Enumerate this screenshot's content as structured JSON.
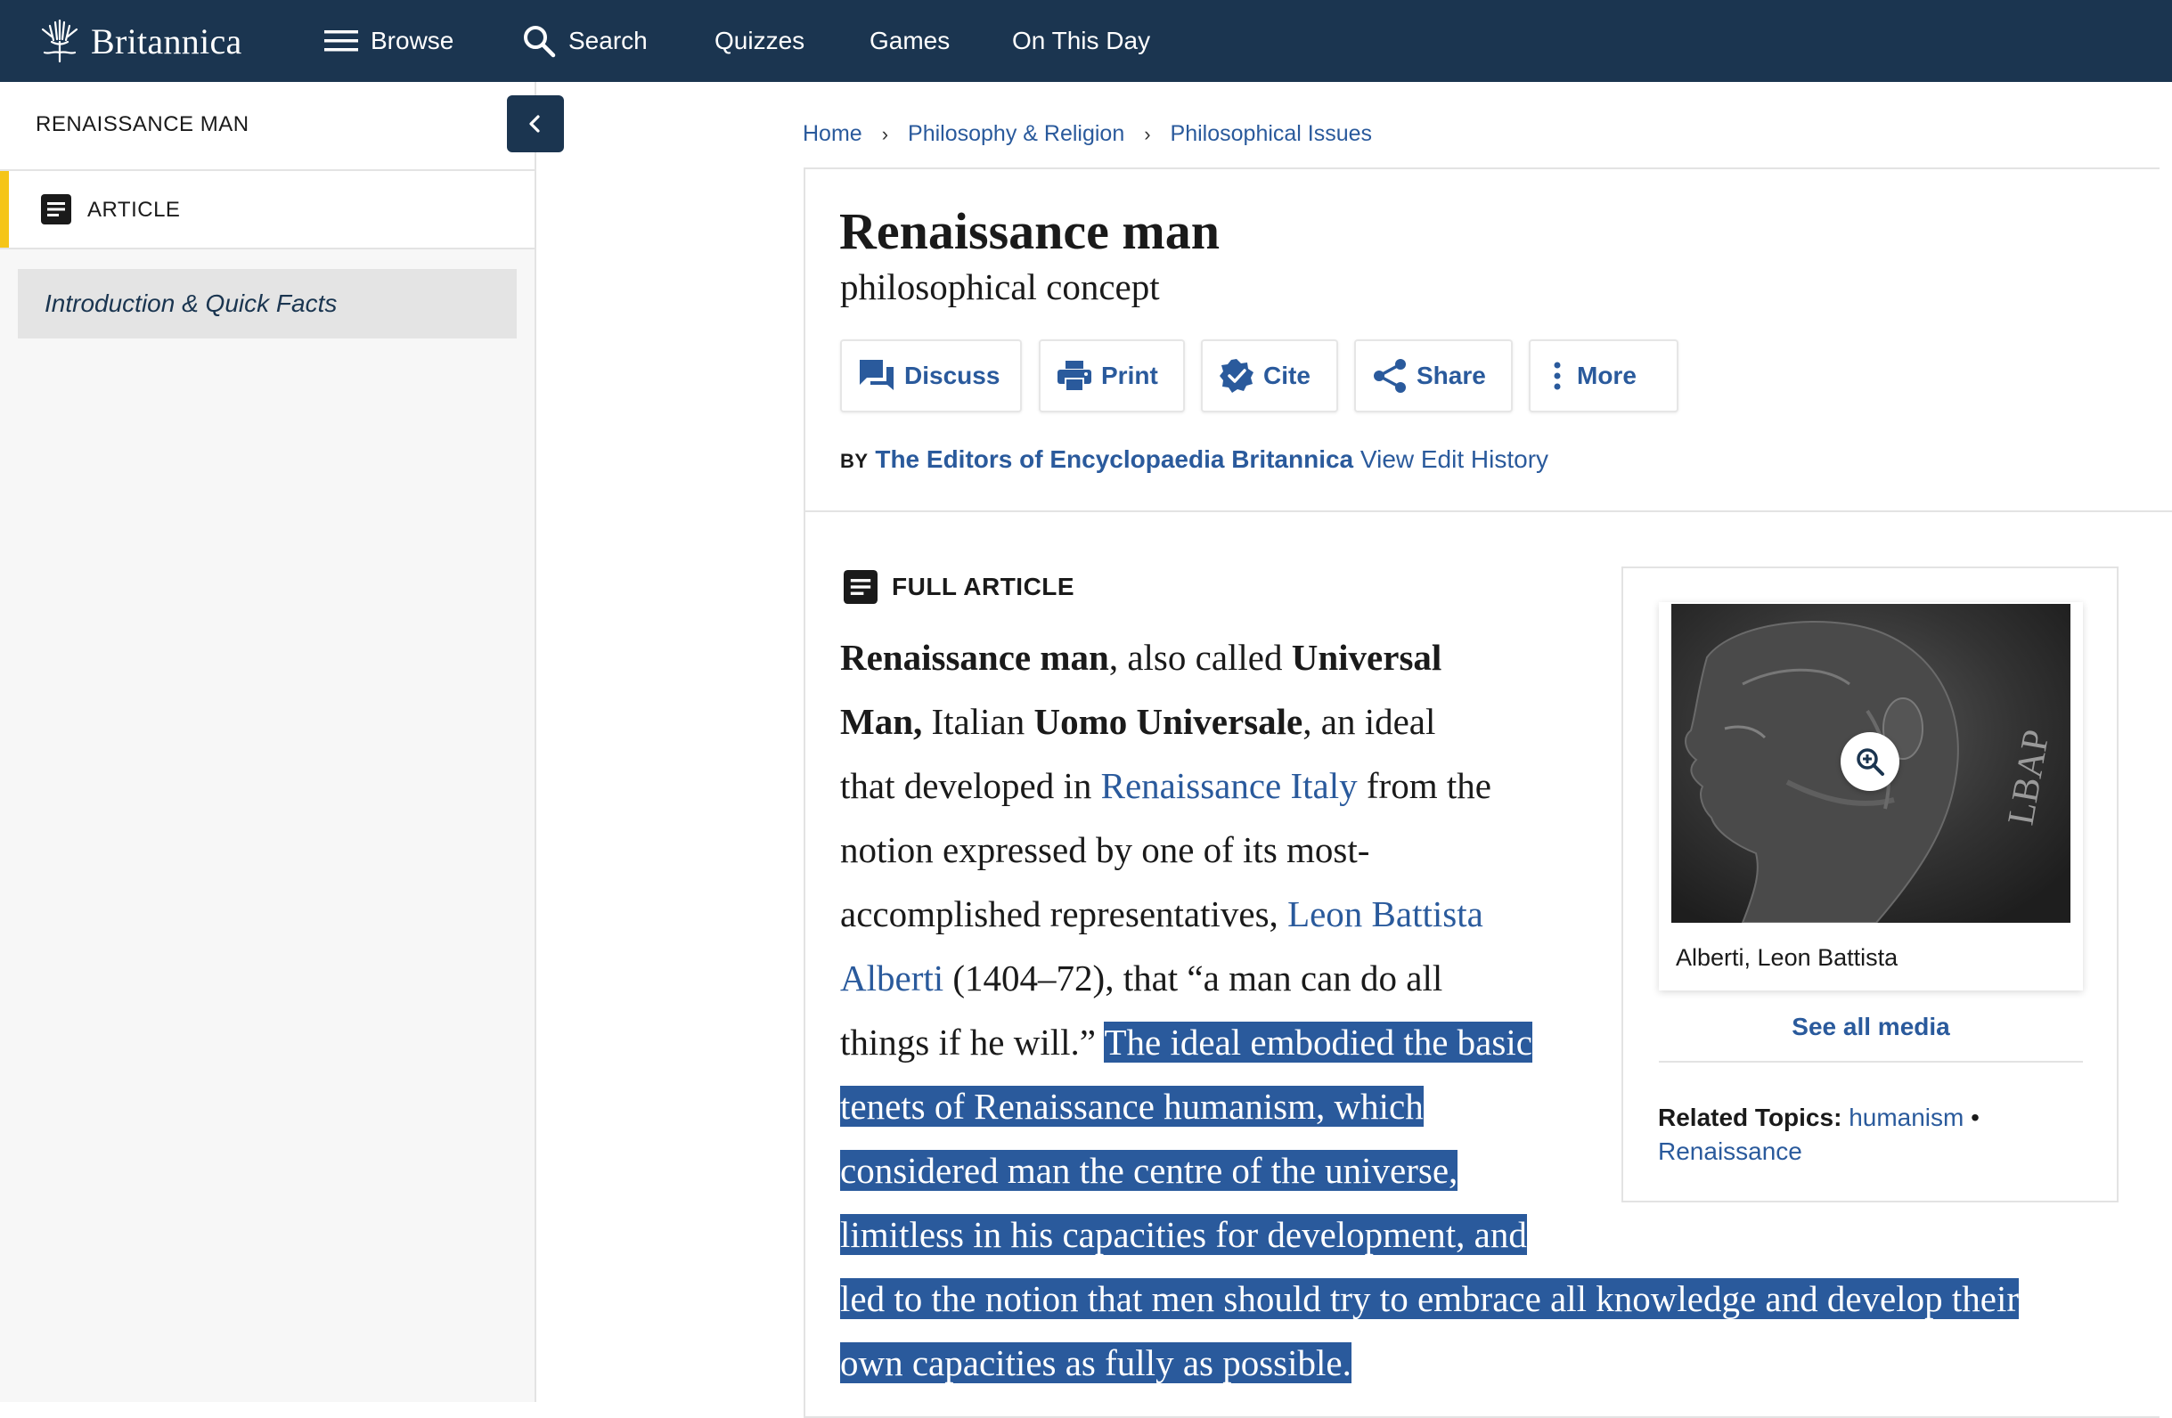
{
  "nav": {
    "logo": "Britannica",
    "items": [
      {
        "label": "Browse",
        "icon": "menu-icon"
      },
      {
        "label": "Search",
        "icon": "search-icon"
      },
      {
        "label": "Quizzes"
      },
      {
        "label": "Games"
      },
      {
        "label": "On This Day"
      }
    ]
  },
  "sidebar": {
    "title": "RENAISSANCE MAN",
    "article_label": "ARTICLE",
    "items": [
      {
        "label": "Introduction & Quick Facts"
      }
    ]
  },
  "breadcrumb": [
    "Home",
    "Philosophy & Religion",
    "Philosophical Issues"
  ],
  "article": {
    "title": "Renaissance man",
    "subtitle": "philosophical concept",
    "actions": [
      {
        "label": "Discuss",
        "icon": "discuss-icon"
      },
      {
        "label": "Print",
        "icon": "print-icon"
      },
      {
        "label": "Cite",
        "icon": "cite-icon"
      },
      {
        "label": "Share",
        "icon": "share-icon"
      },
      {
        "label": "More",
        "icon": "more-icon"
      }
    ],
    "byline": {
      "by": "BY",
      "authors": "The Editors of Encyclopaedia Britannica",
      "history": "View Edit History"
    },
    "full_article_label": "FULL ARTICLE",
    "body": {
      "l1a": "Renaissance man",
      "l1b": ", also called ",
      "l1c": "Universal",
      "l2a": "Man,",
      "l2b": " Italian ",
      "l2c": "Uomo Universale",
      "l2d": ", an ideal",
      "l3a": "that developed in ",
      "l3b": "Renaissance Italy",
      "l3c": " from the",
      "l4": "notion expressed by one of its most-",
      "l5a": "accomplished representatives, ",
      "l5b": "Leon Battista",
      "l6a": "Alberti",
      "l6b": " (1404–72), that “a man can do all",
      "l7a": "things if he will.” ",
      "l7b": "The ideal embodied the basic",
      "l8": "tenets of Renaissance humanism, which",
      "l9": "considered man the centre of the universe,",
      "l10": "limitless in his capacities for development, and",
      "l11": "led to the notion that men should try to embrace all knowledge and develop their",
      "l12": "own capacities as fully as possible."
    }
  },
  "media": {
    "image_label": "LBAP",
    "caption": "Alberti, Leon Battista",
    "see_all": "See all media",
    "related_label": "Related Topics:",
    "related": [
      "humanism",
      "Renaissance"
    ],
    "bullet": "•"
  },
  "colors": {
    "nav_bg": "#1b3550",
    "link": "#2a5a9c",
    "selection": "#2a5a9c",
    "accent": "#f5c518"
  }
}
